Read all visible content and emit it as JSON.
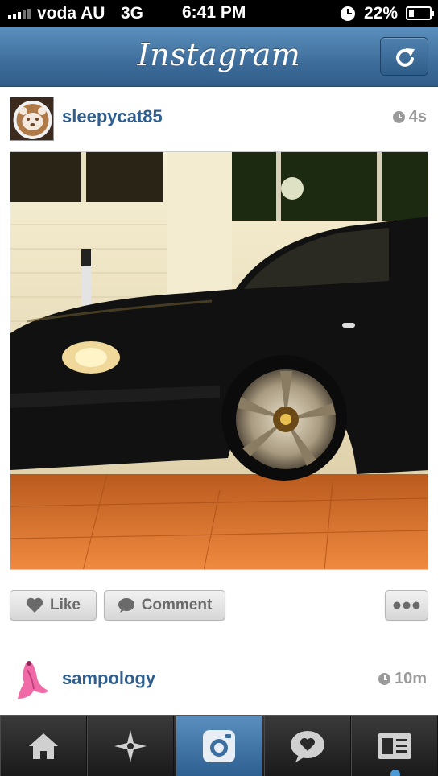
{
  "status_bar": {
    "carrier": "voda AU",
    "network": "3G",
    "time": "6:41 PM",
    "battery": "22%"
  },
  "header": {
    "title": "Instagram",
    "refresh_icon": "refresh-icon"
  },
  "feed": [
    {
      "username": "sleepycat85",
      "time_ago": "4s",
      "avatar": "latte-art-bear-avatar",
      "photo": "black-hatchback-car-night-photo",
      "actions": {
        "like_label": "Like",
        "comment_label": "Comment",
        "more_icon": "ellipsis-icon"
      }
    },
    {
      "username": "sampology",
      "time_ago": "10m",
      "avatar": "pink-banana-avatar"
    }
  ],
  "tab_bar": {
    "tabs": [
      "home-icon",
      "explore-star-icon",
      "camera-icon",
      "news-heart-bubble-icon",
      "profile-card-icon"
    ],
    "active_tab": 2
  },
  "colors": {
    "header_blue": "#3e6d9b",
    "username_blue": "#2f5f8f",
    "tab_active": "#4a7fb0"
  }
}
